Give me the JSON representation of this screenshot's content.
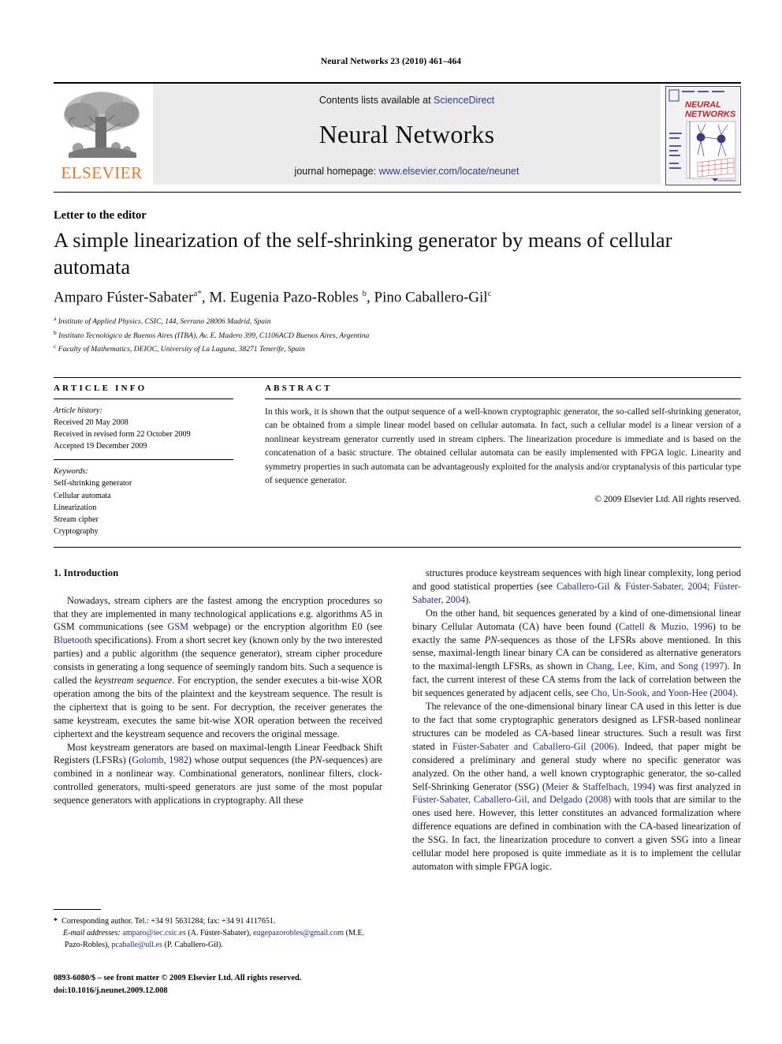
{
  "running_head": "Neural Networks 23 (2010) 461–464",
  "banner": {
    "publisher_name": "ELSEVIER",
    "contents_prefix": "Contents lists available at ",
    "contents_link": "ScienceDirect",
    "journal_name": "Neural Networks",
    "homepage_prefix": "journal homepage: ",
    "homepage_url": "www.elsevier.com/locate/neunet",
    "cover_title_line1": "NEURAL",
    "cover_title_line2": "NETWORKS",
    "link_color": "#2b3a8f",
    "elsevier_orange": "#E87722"
  },
  "article": {
    "type": "Letter to the editor",
    "title": "A simple linearization of the self-shrinking generator by means of cellular automata",
    "authors_html": "Amparo Fúster-Sabater<sup>a</sup><sup>*</sup>, M. Eugenia Pazo-Robles <sup>b</sup>, Pino Caballero-Gil<sup>c</sup>",
    "affiliations": [
      "a Institute of Applied Physics, CSIC, 144, Serrano 28006 Madrid, Spain",
      "b Instituto Tecnológico de Buenos Aires (ITBA), Av. E. Madero 399, C1106ACD Buenos Aires, Argentina",
      "c Faculty of Mathematics, DEIOC, University of La Laguna, 38271 Tenerife, Spain"
    ]
  },
  "info": {
    "heading": "ARTICLE INFO",
    "history_label": "Article history:",
    "history": [
      "Received 20 May 2008",
      "Received in revised form 22 October 2009",
      "Accepted 19 December 2009"
    ],
    "keywords_label": "Keywords:",
    "keywords": [
      "Self-shrinking generator",
      "Cellular automata",
      "Linearization",
      "Stream cipher",
      "Cryptography"
    ]
  },
  "abstract": {
    "heading": "ABSTRACT",
    "text": "In this work, it is shown that the output sequence of a well-known cryptographic generator, the so-called self-shrinking generator, can be obtained from a simple linear model based on cellular automata. In fact, such a cellular model is a linear version of a nonlinear keystream generator currently used in stream ciphers. The linearization procedure is immediate and is based on the concatenation of a basic structure. The obtained cellular automata can be easily implemented with FPGA logic. Linearity and symmetry properties in such automata can be advantageously exploited for the analysis and/or cryptanalysis of this particular type of sequence generator.",
    "copyright": "© 2009 Elsevier Ltd. All rights reserved."
  },
  "body": {
    "section_heading": "1. Introduction",
    "left_paragraphs_html": [
      "Nowadays, stream ciphers are the fastest among the encryption procedures so that they are implemented in many technological applications e.g. algorithms A5 in GSM communications (see <span class=\"cite\">GSM</span> webpage) or the encryption algorithm E0 (see <span class=\"cite\">Bluetooth</span> specifications). From a short secret key (known only by the two interested parties) and a public algorithm (the sequence generator), stream cipher procedure consists in generating a long sequence of seemingly random bits. Such a sequence is called the <span class=\"it\">keystream sequence</span>. For encryption, the sender executes a bit-wise XOR operation among the bits of the plaintext and the keystream sequence. The result is the ciphertext that is going to be sent. For decryption, the receiver generates the same keystream, executes the same bit-wise XOR operation between the received ciphertext and the keystream sequence and recovers the original message.",
      "Most keystream generators are based on maximal-length Linear Feedback Shift Registers (LFSRs) (<span class=\"cite\">Golomb, 1982</span>) whose output sequences (the <span class=\"it\">PN</span>-sequences) are combined in a nonlinear way. Combinational generators, nonlinear filters, clock-controlled generators, multi-speed generators are just some of the most popular sequence generators with applications in cryptography. All these"
    ],
    "right_paragraphs_html": [
      "structures produce keystream sequences with high linear complexity, long period and good statistical properties (see <span class=\"cite\">Caballero-Gil &amp; Fúster-Sabater, 2004</span>; <span class=\"cite\">Fúster-Sabater, 2004</span>).",
      "On the other hand, bit sequences generated by a kind of one-dimensional linear binary Cellular Automata (CA) have been found (<span class=\"cite\">Cattell &amp; Muzio, 1996</span>) to be exactly the same <span class=\"it\">PN</span>-sequences as those of the LFSRs above mentioned. In this sense, maximal-length linear binary CA can be considered as alternative generators to the maximal-length LFSRs, as shown in <span class=\"cite\">Chang, Lee, Kim, and Song (1997)</span>. In fact, the current interest of these CA stems from the lack of correlation between the bit sequences generated by adjacent cells, see <span class=\"cite\">Cho, Un-Sook, and Yoon-Hee (2004)</span>.",
      "The relevance of the one-dimensional binary linear CA used in this letter is due to the fact that some cryptographic generators designed as LFSR-based nonlinear structures can be modeled as CA-based linear structures. Such a result was first stated in <span class=\"cite\">Fúster-Sabater and Caballero-Gil (2006)</span>. Indeed, that paper might be considered a preliminary and general study where no specific generator was analyzed. On the other hand, a well known cryptographic generator, the so-called Self-Shrinking Generator (SSG) (<span class=\"cite\">Meier &amp; Staffelbach, 1994</span>) was first analyzed in <span class=\"cite\">Fúster-Sabater, Caballero-Gil, and Delgado (2008)</span> with tools that are similar to the ones used here. However, this letter constitutes an advanced formalization where difference equations are defined in combination with the CA-based linearization of the SSG. In fact, the linearization procedure to convert a given SSG into a linear cellular model here proposed is quite immediate as it is to implement the cellular automaton with simple FPGA logic."
    ]
  },
  "footnote": {
    "corresponding_html": "<b>*</b>&nbsp; Corresponding author. Tel.: +34 91 5631284; fax: +34 91 4117651.",
    "email_html": "<span class=\"em\">E-mail addresses:</span> <span class=\"mail\">amparo@iec.csic.es</span> (A. Fúster-Sabater), <span class=\"mail\">eugepazorobles@gmail.com</span> (M.E. Pazo-Robles), <span class=\"mail\">pcaballe@ull.es</span> (P. Caballero-Gil)."
  },
  "imprint": {
    "front_matter": "0893-6080/$ – see front matter © 2009 Elsevier Ltd. All rights reserved.",
    "doi": "doi:10.1016/j.neunet.2009.12.008"
  }
}
